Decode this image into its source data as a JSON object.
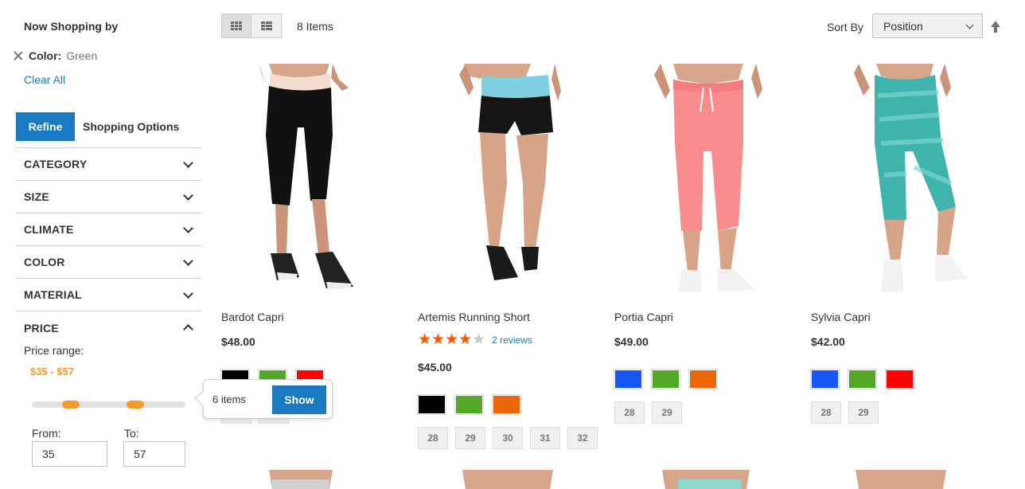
{
  "filters": {
    "heading": "Now Shopping by",
    "active": {
      "label": "Color:",
      "value": "Green"
    },
    "clear_all": "Clear All"
  },
  "tabs": {
    "refine": "Refine",
    "options": "Shopping Options"
  },
  "facets": [
    "CATEGORY",
    "SIZE",
    "CLIMATE",
    "COLOR",
    "MATERIAL"
  ],
  "price": {
    "title": "PRICE",
    "range_label": "Price range:",
    "range_value": "$35 - $57",
    "from_label": "From:",
    "to_label": "To:",
    "from_value": "35",
    "to_value": "57"
  },
  "tooltip": {
    "count": "6 items",
    "button": "Show"
  },
  "toolbar": {
    "items_count": "8 Items",
    "sort_label": "Sort By",
    "sort_value": "Position"
  },
  "colors": {
    "accent": "#1979c3",
    "price_range": "#f49a2c",
    "star": "#ff5501"
  },
  "products": [
    {
      "name": "Bardot Capri",
      "price": "$48.00",
      "swatches": [
        "#000000",
        "#53a828",
        "#ff0000"
      ],
      "sizes": [
        "28",
        "29"
      ]
    },
    {
      "name": "Artemis Running Short",
      "rating": 4,
      "reviews": "2 reviews",
      "price": "$45.00",
      "swatches": [
        "#000000",
        "#53a828",
        "#eb6703"
      ],
      "sizes": [
        "28",
        "29",
        "30",
        "31",
        "32"
      ]
    },
    {
      "name": "Portia Capri",
      "price": "$49.00",
      "swatches": [
        "#1857f7",
        "#53a828",
        "#eb6703"
      ],
      "sizes": [
        "28",
        "29"
      ]
    },
    {
      "name": "Sylvia Capri",
      "price": "$42.00",
      "swatches": [
        "#1857f7",
        "#53a828",
        "#ff0000"
      ],
      "sizes": [
        "28",
        "29"
      ]
    }
  ]
}
